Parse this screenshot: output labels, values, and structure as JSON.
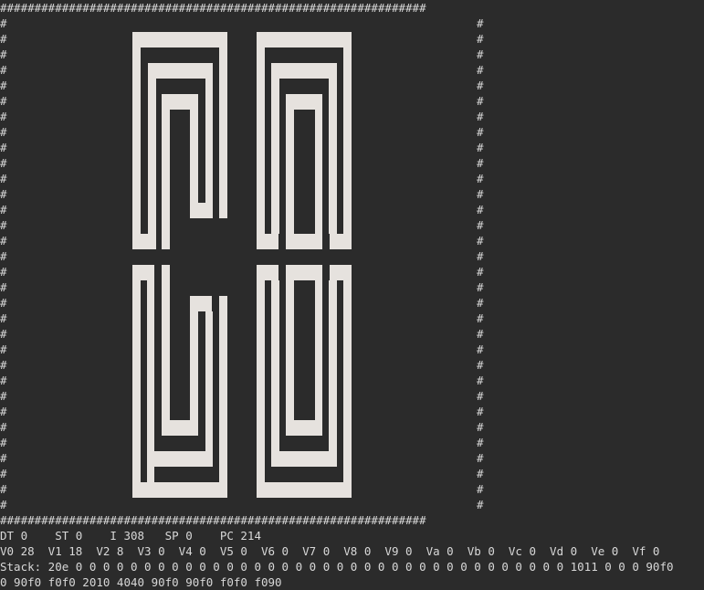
{
  "border": {
    "top_line": "##############################################################",
    "bottom_line": "##############################################################",
    "side_char": "#"
  },
  "status": {
    "line1": "DT 0    ST 0    I 308   SP 0    PC 214",
    "line2": "V0 28  V1 18  V2 8  V3 0  V4 0  V5 0  V6 0  V7 0  V8 0  V9 0  Va 0  Vb 0  Vc 0  Vd 0  Ve 0  Vf 0",
    "line3": "Stack: 20e 0 0 0 0 0 0 0 0 0 0 0 0 0 0 0 0 0 0 0 0 0 0 0 0 0 0 0 0 0 0 0 0 0 0 0 0 1011 0 0 0 90f0",
    "line4": "0 90f0 f0f0 2010 4040 90f0 90f0 f0f0 f090"
  },
  "colors": {
    "background": "#2b2b2b",
    "pixel_on": "#e6e2de",
    "text": "#d8d8d8"
  }
}
